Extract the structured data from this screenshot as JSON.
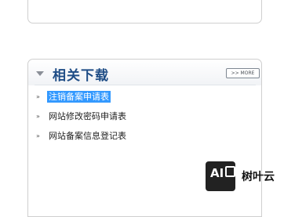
{
  "related_downloads": {
    "title": "相关下载",
    "more_label": ">> MORE",
    "items": [
      {
        "label": "注销备案申请表",
        "selected": true
      },
      {
        "label": "网站修改密码申请表",
        "selected": false
      },
      {
        "label": "网站备案信息登记表",
        "selected": false
      }
    ],
    "bullet_icon": "arrow-right-small-icon",
    "collapse_icon": "triangle-down-icon"
  },
  "watermark": {
    "logo_text": "AI",
    "text": "树叶云"
  },
  "colors": {
    "title": "#1f4d86",
    "selection": "#3399ff",
    "border": "#cfcfcf"
  }
}
